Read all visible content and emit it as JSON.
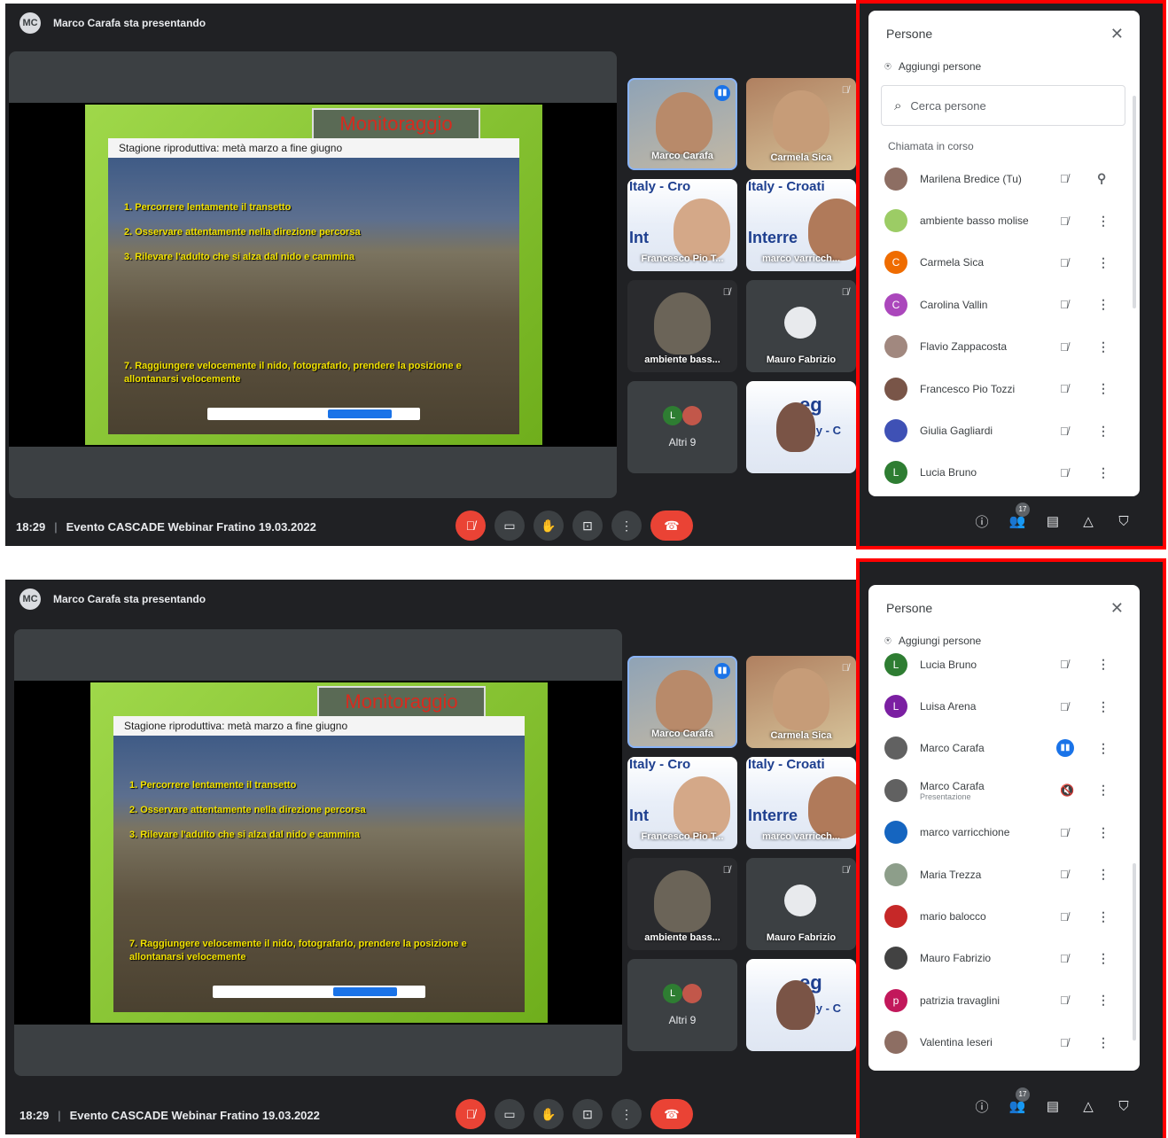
{
  "panels": [
    {
      "meet": {
        "presenting_text": "Marco Carafa sta presentando",
        "slide": {
          "title": "Monitoraggio",
          "subtitle": "Stagione riproduttiva: metà marzo a fine giugno",
          "lines": [
            "1. Percorrere lentamente il transetto",
            "2. Osservare attentamente nella direzione percorsa",
            "3. Rilevare l'adulto che si alza dal nido e cammina",
            "7. Raggiungere velocemente il nido, fotografarlo, prendere la posizione e allontanarsi velocemente"
          ]
        },
        "tiles": [
          {
            "label": "Marco Carafa"
          },
          {
            "label": "Carmela Sica"
          },
          {
            "label": "Francesco Pio T...",
            "brand": "Italy - Cro",
            "brand2": "Int"
          },
          {
            "label": "marco varricch...",
            "brand": "Italy - Croati",
            "brand2": "Interre"
          },
          {
            "label": "ambiente bass..."
          },
          {
            "label": "Mauro Fabrizio"
          },
          {
            "label": "Altri 9",
            "avatar_letter": "L"
          },
          {
            "brand": "eg",
            "brand2": "Italy - C"
          }
        ],
        "time": "18:29",
        "meeting_name": "Evento CASCADE Webinar Fratino 19.03.2022",
        "controls": {
          "mic": "mic-off-icon",
          "camera": "camera-icon",
          "hand": "raise-hand-icon",
          "present": "present-icon",
          "more": "more-icon",
          "hangup": "hangup-icon"
        }
      },
      "people": {
        "title": "Persone",
        "add_label": "Aggiungi persone",
        "search_placeholder": "Cerca persone",
        "section": "Chiamata in corso",
        "participants": [
          {
            "name": "Marilena Bredice (Tu)",
            "color": "#8d6e63",
            "letter": "",
            "status": "mic-off",
            "action": "pin"
          },
          {
            "name": "ambiente basso molise",
            "color": "#9ccc65",
            "letter": "",
            "status": "mic-off",
            "action": "more"
          },
          {
            "name": "Carmela Sica",
            "color": "#ef6c00",
            "letter": "C",
            "status": "mic-off",
            "action": "more"
          },
          {
            "name": "Carolina Vallin",
            "color": "#ab47bc",
            "letter": "C",
            "status": "mic-off",
            "action": "more"
          },
          {
            "name": "Flavio Zappacosta",
            "color": "#a1887f",
            "letter": "",
            "status": "mic-off",
            "action": "more"
          },
          {
            "name": "Francesco Pio Tozzi",
            "color": "#795548",
            "letter": "",
            "status": "mic-off",
            "action": "more"
          },
          {
            "name": "Giulia Gagliardi",
            "color": "#3f51b5",
            "letter": "",
            "status": "mic-off",
            "action": "more"
          },
          {
            "name": "Lucia Bruno",
            "color": "#2e7d32",
            "letter": "L",
            "status": "mic-off",
            "action": "more"
          }
        ],
        "participant_count": "17"
      }
    },
    {
      "meet": {
        "presenting_text": "Marco Carafa sta presentando",
        "slide": {
          "title": "Monitoraggio",
          "subtitle": "Stagione riproduttiva: metà marzo a fine giugno",
          "lines": [
            "1. Percorrere lentamente il transetto",
            "2. Osservare attentamente nella direzione percorsa",
            "3. Rilevare l'adulto che si alza dal nido e cammina",
            "7. Raggiungere velocemente il nido, fotografarlo, prendere la posizione e allontanarsi velocemente"
          ]
        },
        "tiles": [
          {
            "label": "Marco Carafa"
          },
          {
            "label": "Carmela Sica"
          },
          {
            "label": "Francesco Pio T...",
            "brand": "Italy - Cro",
            "brand2": "Int"
          },
          {
            "label": "marco varricch...",
            "brand": "Italy - Croati",
            "brand2": "Interre"
          },
          {
            "label": "ambiente bass..."
          },
          {
            "label": "Mauro Fabrizio"
          },
          {
            "label": "Altri 9",
            "avatar_letter": "L"
          },
          {
            "brand": "eg",
            "brand2": "Italy - C"
          }
        ],
        "time": "18:29",
        "meeting_name": "Evento CASCADE Webinar Fratino 19.03.2022",
        "controls": {
          "mic": "mic-off-icon",
          "camera": "camera-icon",
          "hand": "raise-hand-icon",
          "present": "present-icon",
          "more": "more-icon",
          "hangup": "hangup-icon"
        }
      },
      "people": {
        "title": "Persone",
        "add_label": "Aggiungi persone",
        "participants": [
          {
            "name": "Lucia Bruno",
            "color": "#2e7d32",
            "letter": "L",
            "status": "mic-off",
            "action": "more"
          },
          {
            "name": "Luisa Arena",
            "color": "#7b1fa2",
            "letter": "L",
            "status": "mic-off",
            "action": "more"
          },
          {
            "name": "Marco Carafa",
            "color": "#616161",
            "letter": "",
            "status": "speaking",
            "action": "more"
          },
          {
            "name": "Marco Carafa",
            "sub": "Presentazione",
            "color": "#616161",
            "letter": "",
            "status": "present-muted",
            "action": "more"
          },
          {
            "name": "marco varricchione",
            "color": "#1565c0",
            "letter": "",
            "status": "mic-off",
            "action": "more"
          },
          {
            "name": "Maria Trezza",
            "color": "#8d9e8a",
            "letter": "",
            "status": "mic-off",
            "action": "more"
          },
          {
            "name": "mario balocco",
            "color": "#c62828",
            "letter": "",
            "status": "mic-off",
            "action": "more"
          },
          {
            "name": "Mauro Fabrizio",
            "color": "#424242",
            "letter": "",
            "status": "mic-off",
            "action": "more"
          },
          {
            "name": "patrizia travaglini",
            "color": "#c2185b",
            "letter": "p",
            "status": "mic-off",
            "action": "more"
          },
          {
            "name": "Valentina Ieseri",
            "color": "#8d6e63",
            "letter": "",
            "status": "mic-off",
            "action": "more"
          }
        ],
        "participant_count": "17"
      }
    }
  ]
}
